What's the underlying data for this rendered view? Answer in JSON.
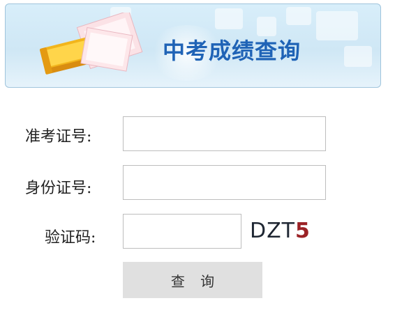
{
  "banner": {
    "title": "中考成绩查询"
  },
  "form": {
    "exam_id": {
      "label": "准考证号:",
      "value": "",
      "placeholder": ""
    },
    "id_number": {
      "label": "身份证号:",
      "value": "",
      "placeholder": ""
    },
    "captcha": {
      "label": "验证码:",
      "value": "",
      "placeholder": "",
      "image_chars": [
        "D",
        "Z",
        "T",
        "5"
      ]
    },
    "submit_label": "查 询"
  },
  "colors": {
    "title": "#1f63b6",
    "button_bg": "#e0e0e0",
    "input_border": "#bdbdbd",
    "captcha_accent": "#9b2226"
  },
  "icons": {
    "banner": "books-icon"
  }
}
